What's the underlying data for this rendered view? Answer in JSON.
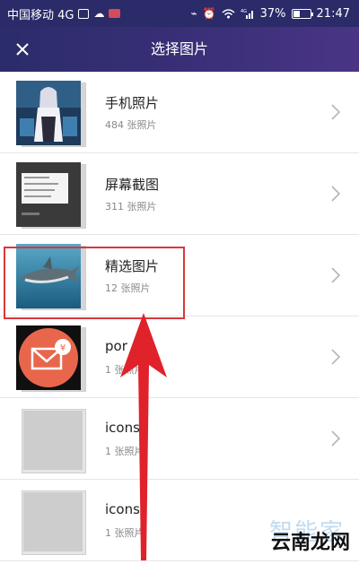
{
  "status_bar": {
    "carrier": "中国移动 4G",
    "network": "4G",
    "battery": "37%",
    "time": "21:47"
  },
  "header": {
    "title": "选择图片",
    "close_icon": "close-icon"
  },
  "albums": [
    {
      "name": "手机照片",
      "count": "484 张照片"
    },
    {
      "name": "屏幕截图",
      "count": "311 张照片"
    },
    {
      "name": "精选图片",
      "count": "12 张照片"
    },
    {
      "name": "por",
      "count": "1 张照片"
    },
    {
      "name": "icons",
      "count": "1 张照片"
    },
    {
      "name": "icons",
      "count": "1 张照片"
    }
  ],
  "watermark": {
    "top": "智能家",
    "bottom": "云南龙网"
  },
  "colors": {
    "header_bg": "#2b2c6b",
    "highlight": "#d9373a",
    "arrow": "#e0222b"
  }
}
